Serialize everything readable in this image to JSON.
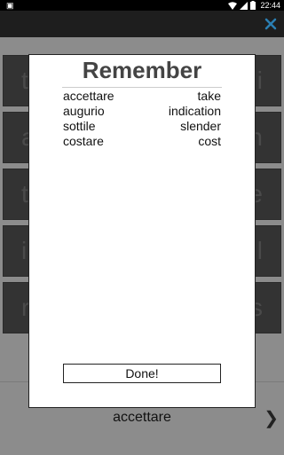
{
  "status_bar": {
    "notification_glyph": "▣",
    "time": "22:44",
    "icons": [
      "wifi-icon",
      "signal-icon",
      "battery-icon"
    ]
  },
  "app_bar": {
    "close_icon": "close-icon",
    "accent_color": "#2b7fb3"
  },
  "background_tiles": [
    {
      "left": "t",
      "right": "i"
    },
    {
      "left": "a",
      "right": "n"
    },
    {
      "left": "t",
      "right": "e"
    },
    {
      "left": "i",
      "right": "l"
    },
    {
      "left": "r",
      "right": "s"
    }
  ],
  "dialog": {
    "title": "Remember",
    "words": [
      {
        "term": "accettare",
        "translation": "take"
      },
      {
        "term": "augurio",
        "translation": "indication"
      },
      {
        "term": "sottile",
        "translation": "slender"
      },
      {
        "term": "costare",
        "translation": "cost"
      }
    ],
    "done_label": "Done!"
  },
  "bottom_bar": {
    "current_word": "accettare",
    "next_glyph": "❯"
  }
}
